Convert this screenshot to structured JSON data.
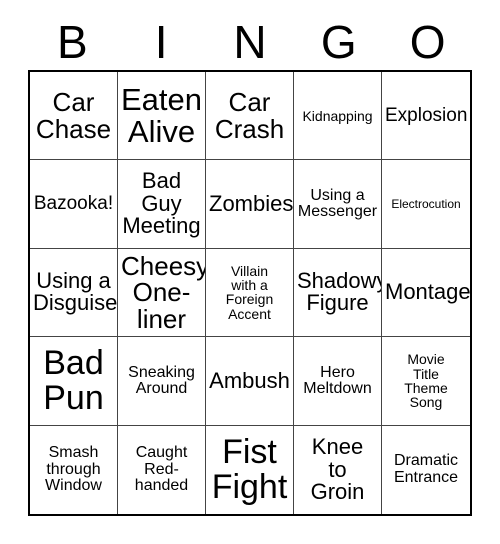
{
  "card": {
    "title": "BINGO",
    "header_letters": [
      "B",
      "I",
      "N",
      "G",
      "O"
    ],
    "rows": 5,
    "columns": 5,
    "colors": {
      "background": "#ffffff",
      "text": "#000000",
      "outer_border": "#000000",
      "inner_border": "#444444"
    },
    "cells": [
      {
        "text": "Car\nChase",
        "size": "lg"
      },
      {
        "text": "Eaten\nAlive",
        "size": "xl"
      },
      {
        "text": "Car\nCrash",
        "size": "lg"
      },
      {
        "text": "Kidnapping",
        "size": "xxs"
      },
      {
        "text": "Explosion",
        "size": "sm"
      },
      {
        "text": "Bazooka!",
        "size": "sm"
      },
      {
        "text": "Bad\nGuy\nMeeting",
        "size": "md"
      },
      {
        "text": "Zombies",
        "size": "md"
      },
      {
        "text": "Using a\nMessenger",
        "size": "xs"
      },
      {
        "text": "Electrocution",
        "size": "tiny"
      },
      {
        "text": "Using a\nDisguise",
        "size": "md"
      },
      {
        "text": "Cheesy\nOne-\nliner",
        "size": "lg"
      },
      {
        "text": "Villain\nwith a\nForeign\nAccent",
        "size": "xxs"
      },
      {
        "text": "Shadowy\nFigure",
        "size": "md"
      },
      {
        "text": "Montage",
        "size": "md"
      },
      {
        "text": "Bad\nPun",
        "size": "xxl"
      },
      {
        "text": "Sneaking\nAround",
        "size": "xs"
      },
      {
        "text": "Ambush",
        "size": "md"
      },
      {
        "text": "Hero\nMeltdown",
        "size": "xs"
      },
      {
        "text": "Movie\nTitle\nTheme\nSong",
        "size": "xxs"
      },
      {
        "text": "Smash\nthrough\nWindow",
        "size": "xs"
      },
      {
        "text": "Caught\nRed-\nhanded",
        "size": "xs"
      },
      {
        "text": "Fist\nFight",
        "size": "xxl"
      },
      {
        "text": "Knee\nto\nGroin",
        "size": "md"
      },
      {
        "text": "Dramatic\nEntrance",
        "size": "xs"
      }
    ]
  }
}
